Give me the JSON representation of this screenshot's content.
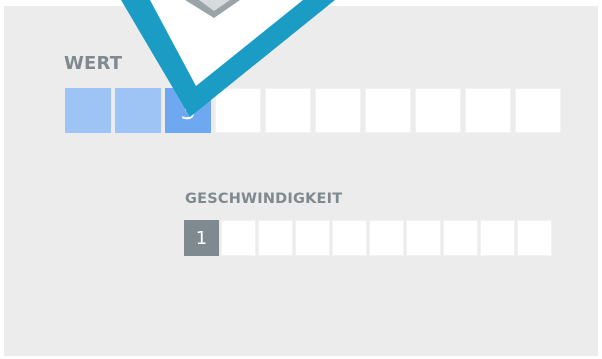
{
  "wert": {
    "label": "WERT",
    "total_cells": 10,
    "filled_cells": 3,
    "value": "3"
  },
  "geschwindigkeit": {
    "label": "GESCHWINDIGKEIT",
    "total_cells": 10,
    "filled_cells": 1,
    "value": "1"
  },
  "colors": {
    "panel_background": "#ececec",
    "wert_filled": "#9dc4f5",
    "wert_current": "#6ea8f0",
    "speed_current": "#7f8a90",
    "label_text": "#7f8a90",
    "card_frame": "#1a9cc4"
  }
}
